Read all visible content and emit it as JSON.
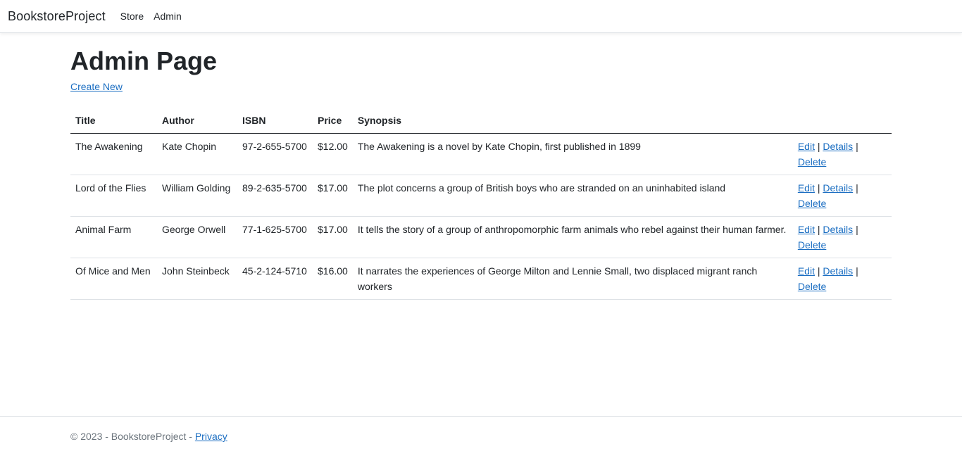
{
  "navbar": {
    "brand": "BookstoreProject",
    "links": [
      "Store",
      "Admin"
    ]
  },
  "page": {
    "title": "Admin Page",
    "create_new": "Create New"
  },
  "table": {
    "headers": [
      "Title",
      "Author",
      "ISBN",
      "Price",
      "Synopsis"
    ],
    "rows": [
      {
        "title": "The Awakening",
        "author": "Kate Chopin",
        "isbn": "97-2-655-5700",
        "price": "$12.00",
        "synopsis": "The Awakening is a novel by Kate Chopin, first published in 1899"
      },
      {
        "title": "Lord of the Flies",
        "author": "William Golding",
        "isbn": "89-2-635-5700",
        "price": "$17.00",
        "synopsis": "The plot concerns a group of British boys who are stranded on an uninhabited island"
      },
      {
        "title": "Animal Farm",
        "author": "George Orwell",
        "isbn": "77-1-625-5700",
        "price": "$17.00",
        "synopsis": "It tells the story of a group of anthropomorphic farm animals who rebel against their human farmer."
      },
      {
        "title": "Of Mice and Men",
        "author": "John Steinbeck",
        "isbn": "45-2-124-5710",
        "price": "$16.00",
        "synopsis": "It narrates the experiences of George Milton and Lennie Small, two displaced migrant ranch workers"
      }
    ],
    "actions": {
      "edit": "Edit",
      "details": "Details",
      "delete": "Delete",
      "separator": "|"
    }
  },
  "footer": {
    "text": "© 2023 - BookstoreProject - ",
    "privacy": "Privacy"
  }
}
